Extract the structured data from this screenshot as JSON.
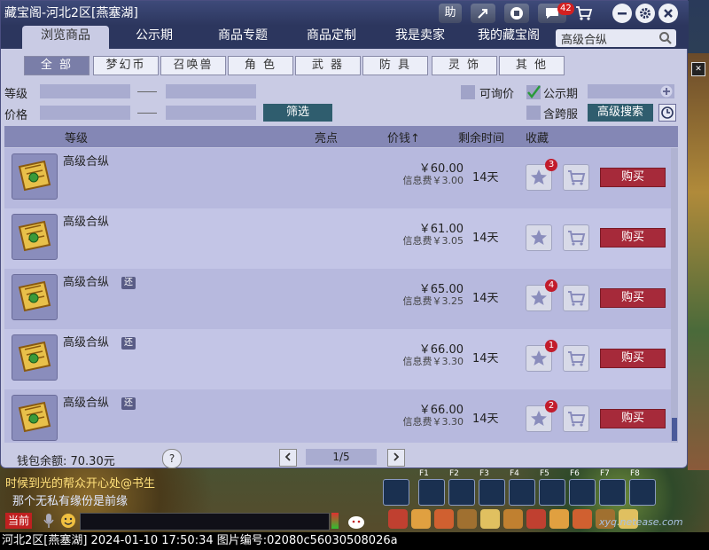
{
  "window": {
    "title": "藏宝阁-河北2区[燕塞湖]",
    "toolbar": {
      "help_label": "助",
      "message_count": "42"
    },
    "tabs": [
      {
        "label": "浏览商品",
        "active": true
      },
      {
        "label": "公示期"
      },
      {
        "label": "商品专题"
      },
      {
        "label": "商品定制"
      },
      {
        "label": "我是卖家"
      },
      {
        "label": "我的藏宝阁"
      }
    ],
    "search": {
      "value": "高级合纵"
    }
  },
  "categories": [
    "全 部",
    "梦幻币",
    "召唤兽",
    "角 色",
    "武 器",
    "防 具",
    "灵 饰",
    "其 他"
  ],
  "filters": {
    "level_label": "等级",
    "price_label": "价格",
    "filter_button": "筛选",
    "inquiry_label": "可询价",
    "public_label": "公示期",
    "cross_server_label": "含跨服",
    "advanced_search": "高级搜索"
  },
  "table": {
    "headers": {
      "level": "等级",
      "highlight": "亮点",
      "price": "价钱↑",
      "remaining": "剩余时间",
      "favorite": "收藏"
    },
    "rows": [
      {
        "name": "高级合纵",
        "tag": "",
        "price": "￥60.00",
        "fee": "信息费￥3.00",
        "remaining": "14天",
        "favorites": "3",
        "buy": "购买"
      },
      {
        "name": "高级合纵",
        "tag": "",
        "price": "￥61.00",
        "fee": "信息费￥3.05",
        "remaining": "14天",
        "favorites": "",
        "buy": "购买"
      },
      {
        "name": "高级合纵",
        "tag": "还",
        "price": "￥65.00",
        "fee": "信息费￥3.25",
        "remaining": "14天",
        "favorites": "4",
        "buy": "购买"
      },
      {
        "name": "高级合纵",
        "tag": "还",
        "price": "￥66.00",
        "fee": "信息费￥3.30",
        "remaining": "14天",
        "favorites": "1",
        "buy": "购买"
      },
      {
        "name": "高级合纵",
        "tag": "还",
        "price": "￥66.00",
        "fee": "信息费￥3.30",
        "remaining": "14天",
        "favorites": "2",
        "buy": "购买"
      }
    ]
  },
  "footer": {
    "wallet": "钱包余额: 70.30元",
    "help": "?",
    "page": "1/5"
  },
  "game": {
    "chat_line1": "时候到光的帮众开心处@书生",
    "chat_line2": "那个无私有缘份是前缘",
    "channel": "当前",
    "fkeys": [
      "F1",
      "F2",
      "F3",
      "F4",
      "F5",
      "F6",
      "F7",
      "F8"
    ],
    "watermark": "xyq.netease.com",
    "status": "河北2区[燕塞湖] 2024-01-10 17:50:34 图片编号:02080c56030508026a"
  },
  "colors": {
    "accent": "#2c365e",
    "buy": "#a62a3a",
    "badge": "#c21c2c"
  }
}
